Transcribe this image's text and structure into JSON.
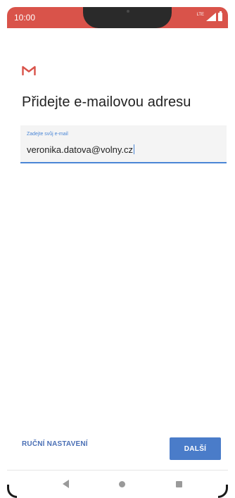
{
  "status_bar": {
    "time": "10:00",
    "network": "LTE",
    "background_color": "#d9534a"
  },
  "app": {
    "logo_icon": "gmail-m-icon",
    "title": "Přidejte e-mailovou adresu"
  },
  "email_field": {
    "label": "Zadejte svůj e-mail",
    "value": "veronika.datova@volny.cz",
    "accent_color": "#4a86d6"
  },
  "actions": {
    "manual_setup_label": "RUČNÍ NASTAVENÍ",
    "next_label": "DALŠÍ",
    "button_color": "#4a7cc9"
  },
  "navigation": {
    "back_icon": "back-triangle-icon",
    "home_icon": "home-circle-icon",
    "recents_icon": "recents-square-icon"
  }
}
